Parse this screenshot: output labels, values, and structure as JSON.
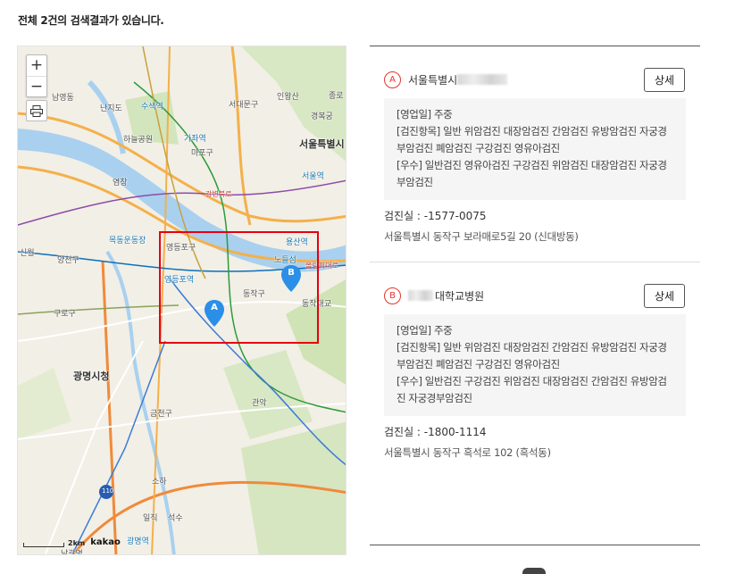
{
  "summary": "전체 2건의 검색결과가 있습니다.",
  "map": {
    "zoom_in": "+",
    "zoom_out": "−",
    "scale": "2km",
    "provider": "kakao",
    "labels": {
      "l1": "남영동",
      "l2": "난지도",
      "l3": "수색역",
      "l4": "하늘공원",
      "l5": "가좌역",
      "l6": "마포구",
      "l7": "서울특별시",
      "l8": "서울역",
      "l9": "인왕산",
      "l10": "종로",
      "l11": "경복궁",
      "l12": "서대문구",
      "l13": "영등포구",
      "l14": "영등포역",
      "l15": "동작구",
      "l16": "노들섬",
      "l17": "용산역",
      "l18": "목동운동장",
      "l19": "양천구",
      "l20": "신월",
      "l21": "구로구",
      "l22": "광명시청",
      "l23": "금천구",
      "l24": "관악",
      "l25": "광명역",
      "l26": "남광명",
      "l27": "동작대교",
      "l28": "염창",
      "l29": "강변북로",
      "l30": "올림픽대로",
      "l31": "석수",
      "l32": "일직",
      "l33": "소하",
      "l34": "110"
    },
    "markers": [
      "A",
      "B"
    ]
  },
  "results": [
    {
      "letter": "A",
      "name": "서울특별시",
      "detail": "상세",
      "hours": "[영업일] 주중",
      "items": "[검진항목] 일반 위암검진 대장암검진 간암검진 유방암검진 자궁경부암검진 폐암검진 구강검진 영유아검진",
      "best": "[우수] 일반검진 영유아검진 구강검진 위암검진 대장암검진 자궁경부암검진",
      "phone": "검진실 : -1577-0075",
      "address": "서울특별시 동작구 보라매로5길 20 (신대방동)"
    },
    {
      "letter": "B",
      "name": "대학교병원",
      "detail": "상세",
      "hours": "[영업일] 주중",
      "items": "[검진항목] 일반 위암검진 대장암검진 간암검진 유방암검진 자궁경부암검진 폐암검진 구강검진 영유아검진",
      "best": "[우수] 일반검진 구강검진 위암검진 대장암검진 간암검진 유방암검진 자궁경부암검진",
      "phone": "검진실 : -1800-1114",
      "address": "서울특별시 동작구 흑석로 102 (흑석동)"
    }
  ],
  "colors": {
    "river": "#9dc8e8",
    "park": "#cfe3b5",
    "accent": "#e4352b",
    "marker": "#2b8fe8"
  }
}
